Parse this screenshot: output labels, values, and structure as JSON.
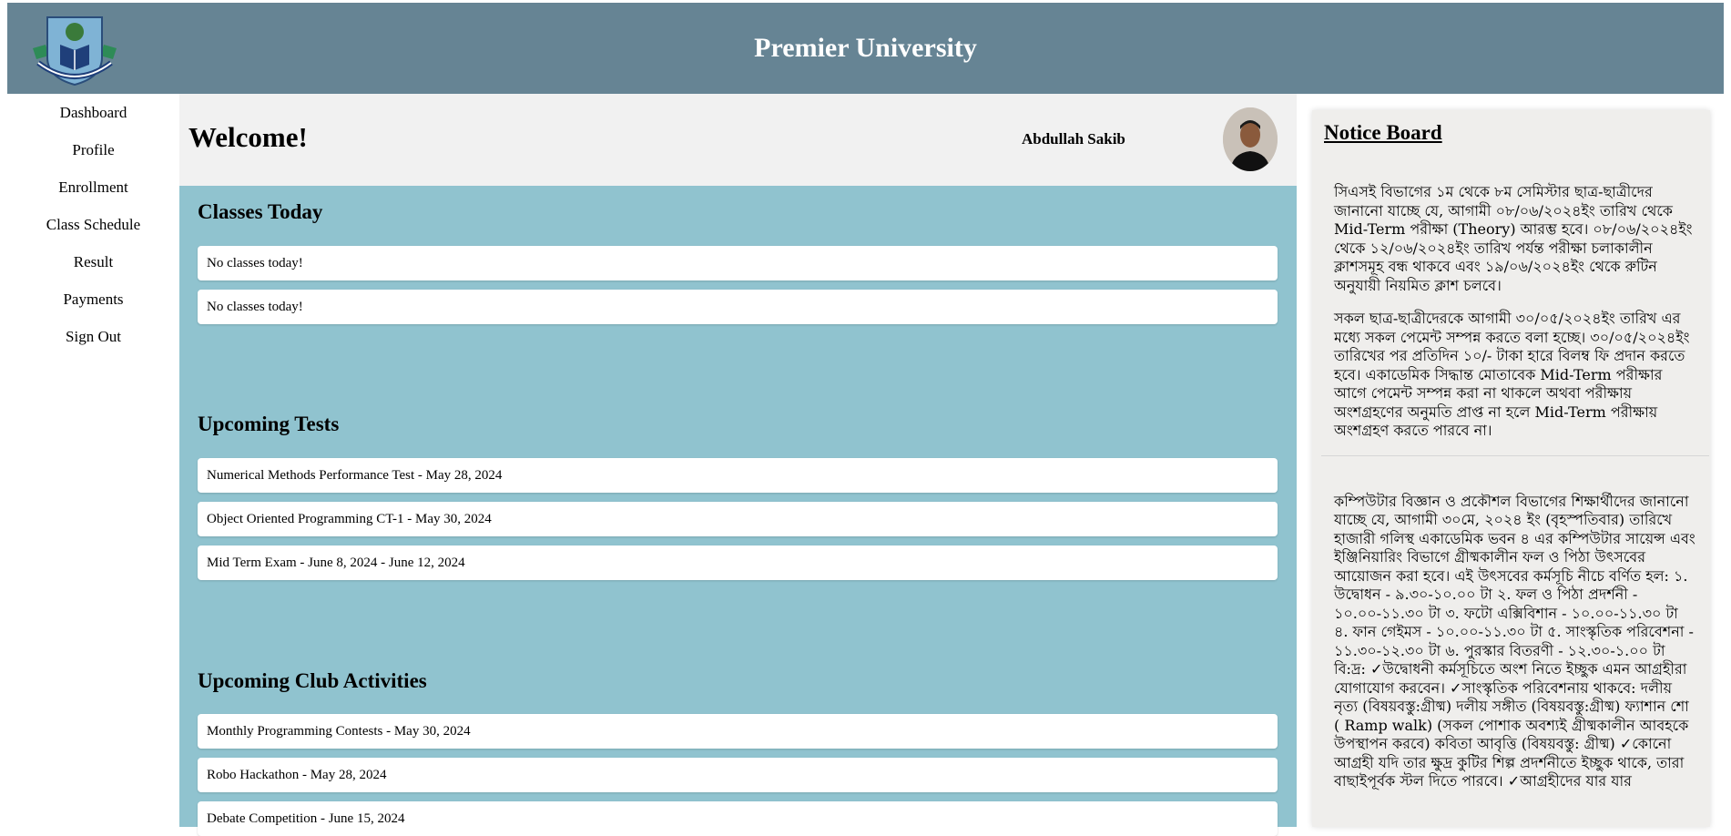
{
  "header": {
    "title": "Premier University",
    "logo_icon": "university-crest-logo"
  },
  "sidebar": {
    "items": [
      {
        "label": "Dashboard"
      },
      {
        "label": "Profile"
      },
      {
        "label": "Enrollment"
      },
      {
        "label": "Class Schedule"
      },
      {
        "label": "Result"
      },
      {
        "label": "Payments"
      },
      {
        "label": "Sign Out"
      }
    ]
  },
  "welcome": {
    "title": "Welcome!",
    "user_name": "Abdullah Sakib",
    "avatar_icon": "user-avatar"
  },
  "sections": {
    "classes_today": {
      "title": "Classes Today",
      "items": [
        "No classes today!",
        "No classes today!"
      ]
    },
    "upcoming_tests": {
      "title": "Upcoming Tests",
      "items": [
        "Numerical Methods Performance Test - May 28, 2024",
        "Object Oriented Programming CT-1 - May 30, 2024",
        "Mid Term Exam - June 8, 2024 - June 12, 2024"
      ]
    },
    "club_activities": {
      "title": "Upcoming Club Activities",
      "items": [
        "Monthly Programming Contests - May 30, 2024",
        "Robo Hackathon - May 28, 2024",
        "Debate Competition - June 15, 2024"
      ]
    }
  },
  "notice_board": {
    "title": "Notice Board",
    "notices": [
      "সিএসই বিভাগের ১ম থেকে ৮ম সেমিস্টার ছাত্র-ছাত্রীদের জানানো যাচ্ছে যে, আগামী ০৮/০৬/২০২৪ইং তারিখ থেকে Mid-Term পরীক্ষা (Theory) আরম্ভ হবে। ০৮/০৬/২০২৪ইং থেকে ১২/০৬/২০২৪ইং তারিখ পর্যন্ত পরীক্ষা চলাকালীন ক্লাশসমূহ বন্ধ থাকবে এবং ১৯/০৬/২০২৪ইং থেকে রুটিন অনুযায়ী নিয়মিত ক্লাশ চলবে।",
      "সকল ছাত্র-ছাত্রীদেরকে আগামী ৩০/০৫/২০২৪ইং তারিখ এর মধ্যে সকল পেমেন্ট সম্পন্ন করতে বলা হচ্ছে। ৩০/০৫/২০২৪ইং তারিখের পর প্রতিদিন ১০/- টাকা হারে বিলম্ব ফি প্রদান করতে হবে। একাডেমিক সিদ্ধান্ত মোতাবেক Mid-Term পরীক্ষার আগে পেমেন্ট সম্পন্ন করা না থাকলে অথবা পরীক্ষায় অংশগ্রহণের অনুমতি প্রাপ্ত না হলে Mid-Term পরীক্ষায় অংশগ্রহণ করতে পারবে না।",
      "কম্পিউটার বিজ্ঞান ও প্রকৌশল বিভাগের শিক্ষার্থীদের জানানো যাচ্ছে যে, আগামী ৩০মে, ২০২৪ ইং (বৃহস্পতিবার) তারিখে হাজারী গলিস্থ একাডেমিক ভবন ৪ এর কম্পিউটার সায়েন্স এবং ইঞ্জিনিয়ারিং বিভাগে গ্রীষ্মকালীন ফল ও পিঠা উৎসবের আয়োজন করা হবে। এই উৎসবের কর্মসূচি নীচে বর্ণিত হল: ১. উদ্বোধন - ৯.৩০-১০.০০ টা ২. ফল ও পিঠা প্রদর্শনী - ১০.০০-১১.৩০ টা ৩. ফটো এক্সিবিশান - ১০.০০-১১.৩০ টা ৪. ফান গেইমস - ১০.০০-১১.৩০ টা ৫. সাংস্কৃতিক পরিবেশনা - ১১.৩০-১২.৩০ টা ৬. পুরস্কার বিতরণী - ১২.৩০-১.০০ টা বি:দ্র: ✓উদ্বোধনী কর্মসূচিতে অংশ নিতে ইচ্ছুক এমন আগ্রহীরা যোগাযোগ করবেন। ✓সাংস্কৃতিক পরিবেশনায় থাকবে: দলীয় নৃত্য (বিষয়বস্তু:গ্রীষ্ম) দলীয় সঙ্গীত (বিষয়বস্তু:গ্রীষ্ম) ফ্যাশান শো ( Ramp walk) (সকল পোশাক অবশ্যই গ্রীষ্মকালীন আবহকে উপস্থাপন করবে) কবিতা আবৃত্তি (বিষয়বস্তু: গ্রীষ্ম) ✓কোনো আগ্রহী যদি তার ক্ষুদ্র কুটির শিল্প প্রদর্শনীতে ইচ্ছুক থাকে, তারা বাছাইপূর্বক স্টল দিতে পারবে। ✓আগ্রহীদের যার যার"
    ]
  },
  "colors": {
    "header_bg": "#668494",
    "main_bg": "#90c3cf",
    "welcome_bg": "#f1f1f1",
    "notice_bg": "#efeeec"
  }
}
